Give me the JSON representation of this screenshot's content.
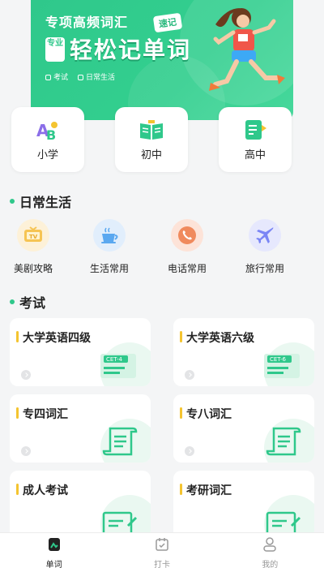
{
  "banner": {
    "subtitle": "专项高频词汇",
    "sticker": "速记",
    "pro_tag": "专业",
    "main_title": "轻松记单词",
    "tags": [
      "考试",
      "日常生活"
    ]
  },
  "levels": [
    {
      "label": "小学",
      "icon": "abc-letters-icon"
    },
    {
      "label": "初中",
      "icon": "open-book-icon"
    },
    {
      "label": "高中",
      "icon": "notebook-icon"
    }
  ],
  "daily": {
    "title": "日常生活",
    "items": [
      {
        "label": "美剧攻略",
        "icon": "tv-icon",
        "color": "#f6c453"
      },
      {
        "label": "生活常用",
        "icon": "coffee-cup-icon",
        "color": "#5aa8f0"
      },
      {
        "label": "电话常用",
        "icon": "phone-icon",
        "color": "#f08a5d"
      },
      {
        "label": "旅行常用",
        "icon": "airplane-icon",
        "color": "#7a85f5"
      }
    ]
  },
  "exam": {
    "title": "考试",
    "items": [
      {
        "label": "大学英语四级",
        "badge": "CET-4"
      },
      {
        "label": "大学英语六级",
        "badge": "CET-6"
      },
      {
        "label": "专四词汇"
      },
      {
        "label": "专八词汇"
      },
      {
        "label": "成人考试"
      },
      {
        "label": "考研词汇"
      }
    ]
  },
  "tabbar": {
    "items": [
      {
        "label": "单词",
        "icon": "words-icon",
        "active": true
      },
      {
        "label": "打卡",
        "icon": "calendar-check-icon",
        "active": false
      },
      {
        "label": "我的",
        "icon": "profile-icon",
        "active": false
      }
    ]
  },
  "colors": {
    "accent": "#2fc88b",
    "exam_marker": "#f4c430"
  }
}
